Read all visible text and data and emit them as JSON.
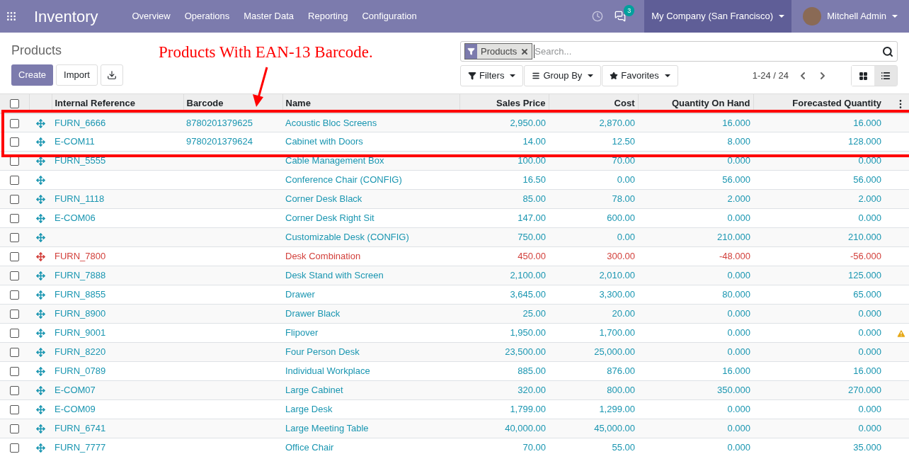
{
  "navbar": {
    "app_title": "Inventory",
    "menu": [
      "Overview",
      "Operations",
      "Master Data",
      "Reporting",
      "Configuration"
    ],
    "messages_count": "3",
    "company": "My Company (San Francisco)",
    "user": "Mitchell Admin"
  },
  "control_panel": {
    "breadcrumb": "Products",
    "buttons": [
      "Create",
      "Import"
    ],
    "facet": "Products",
    "search_placeholder": "Search...",
    "filters": [
      "Filters",
      "Group By",
      "Favorites"
    ],
    "pager": "1-24 / 24",
    "views": [
      {
        "kind": "kanban",
        "selected": false
      },
      {
        "kind": "list",
        "selected": true
      }
    ]
  },
  "annotation": "Products With EAN-13 Barcode.",
  "table": {
    "select_all_checked": false,
    "columns": [
      "Internal Reference",
      "Barcode",
      "Name",
      "Sales Price",
      "Cost",
      "Quantity On Hand",
      "Forecasted Quantity"
    ],
    "rows": [
      {
        "ref": "FURN_6666",
        "barcode": "8780201379625",
        "name": "Acoustic Bloc Screens",
        "price": "2,950.00",
        "cost": "2,870.00",
        "on_hand": "16.000",
        "forecast": "16.000",
        "negative": false,
        "warning": false,
        "checked": false
      },
      {
        "ref": "E-COM11",
        "barcode": "9780201379624",
        "name": "Cabinet with Doors",
        "price": "14.00",
        "cost": "12.50",
        "on_hand": "8.000",
        "forecast": "128.000",
        "negative": false,
        "warning": false,
        "checked": false
      },
      {
        "ref": "FURN_5555",
        "name": "Cable Management Box",
        "price": "100.00",
        "cost": "70.00",
        "on_hand": "0.000",
        "forecast": "0.000",
        "negative": false,
        "warning": false,
        "checked": false
      },
      {
        "name": "Conference Chair (CONFIG)",
        "price": "16.50",
        "cost": "0.00",
        "on_hand": "56.000",
        "forecast": "56.000",
        "negative": false,
        "warning": false,
        "checked": false
      },
      {
        "ref": "FURN_1118",
        "name": "Corner Desk Black",
        "price": "85.00",
        "cost": "78.00",
        "on_hand": "2.000",
        "forecast": "2.000",
        "negative": false,
        "warning": false,
        "checked": false
      },
      {
        "ref": "E-COM06",
        "name": "Corner Desk Right Sit",
        "price": "147.00",
        "cost": "600.00",
        "on_hand": "0.000",
        "forecast": "0.000",
        "negative": false,
        "warning": false,
        "checked": false
      },
      {
        "name": "Customizable Desk (CONFIG)",
        "price": "750.00",
        "cost": "0.00",
        "on_hand": "210.000",
        "forecast": "210.000",
        "negative": false,
        "warning": false,
        "checked": false
      },
      {
        "ref": "FURN_7800",
        "name": "Desk Combination",
        "price": "450.00",
        "cost": "300.00",
        "on_hand": "-48.000",
        "forecast": "-56.000",
        "negative": true,
        "warning": false,
        "checked": false
      },
      {
        "ref": "FURN_7888",
        "name": "Desk Stand with Screen",
        "price": "2,100.00",
        "cost": "2,010.00",
        "on_hand": "0.000",
        "forecast": "125.000",
        "negative": false,
        "warning": false,
        "checked": false
      },
      {
        "ref": "FURN_8855",
        "name": "Drawer",
        "price": "3,645.00",
        "cost": "3,300.00",
        "on_hand": "80.000",
        "forecast": "65.000",
        "negative": false,
        "warning": false,
        "checked": false
      },
      {
        "ref": "FURN_8900",
        "name": "Drawer Black",
        "price": "25.00",
        "cost": "20.00",
        "on_hand": "0.000",
        "forecast": "0.000",
        "negative": false,
        "warning": false,
        "checked": false
      },
      {
        "ref": "FURN_9001",
        "name": "Flipover",
        "price": "1,950.00",
        "cost": "1,700.00",
        "on_hand": "0.000",
        "forecast": "0.000",
        "negative": false,
        "warning": true,
        "checked": false
      },
      {
        "ref": "FURN_8220",
        "name": "Four Person Desk",
        "price": "23,500.00",
        "cost": "25,000.00",
        "on_hand": "0.000",
        "forecast": "0.000",
        "negative": false,
        "warning": false,
        "checked": false
      },
      {
        "ref": "FURN_0789",
        "name": "Individual Workplace",
        "price": "885.00",
        "cost": "876.00",
        "on_hand": "16.000",
        "forecast": "16.000",
        "negative": false,
        "warning": false,
        "checked": false
      },
      {
        "ref": "E-COM07",
        "name": "Large Cabinet",
        "price": "320.00",
        "cost": "800.00",
        "on_hand": "350.000",
        "forecast": "270.000",
        "negative": false,
        "warning": false,
        "checked": false
      },
      {
        "ref": "E-COM09",
        "name": "Large Desk",
        "price": "1,799.00",
        "cost": "1,299.00",
        "on_hand": "0.000",
        "forecast": "0.000",
        "negative": false,
        "warning": false,
        "checked": false
      },
      {
        "ref": "FURN_6741",
        "name": "Large Meeting Table",
        "price": "40,000.00",
        "cost": "45,000.00",
        "on_hand": "0.000",
        "forecast": "0.000",
        "negative": false,
        "warning": false,
        "checked": false
      },
      {
        "ref": "FURN_7777",
        "name": "Office Chair",
        "price": "70.00",
        "cost": "55.00",
        "on_hand": "0.000",
        "forecast": "35.000",
        "negative": false,
        "warning": false,
        "checked": false
      }
    ]
  }
}
